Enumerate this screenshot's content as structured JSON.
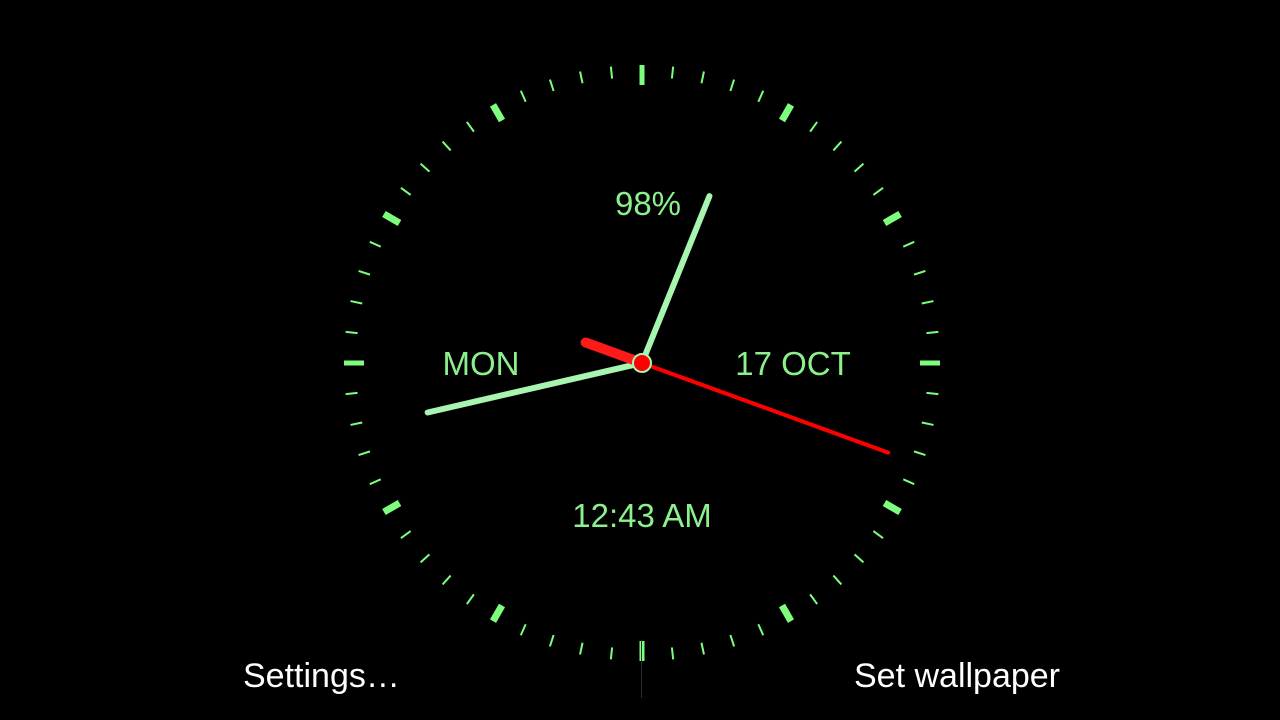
{
  "clock": {
    "battery": "98%",
    "day": "MON",
    "date": "17 OCT",
    "time": "12:43 AM",
    "hour_angle_deg": 290,
    "minute_angle_deg": 257,
    "second_angle_deg": 110,
    "colors": {
      "face_tick": "#7dff7d",
      "minute_hand": "#a8f5b0",
      "hour_hand": "#ff1a1a",
      "second_hand": "#ff0000",
      "text": "#8cf08c",
      "background": "#000000"
    }
  },
  "actions": {
    "settings_label": "Settings…",
    "set_wallpaper_label": "Set wallpaper"
  }
}
